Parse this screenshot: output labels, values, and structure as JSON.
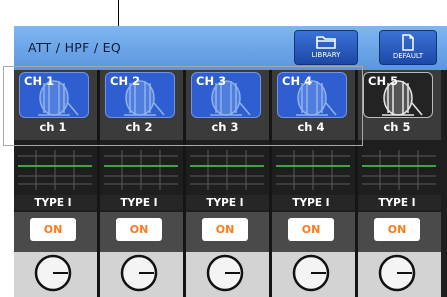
{
  "header": {
    "title": "ATT / HPF / EQ"
  },
  "buttons": {
    "library": "LIBRARY",
    "default": "DEFAULT"
  },
  "channels": [
    {
      "icon_label": "CH 1",
      "name": "ch 1",
      "eq_type": "TYPE I",
      "on_label": "ON",
      "selected": false
    },
    {
      "icon_label": "CH 2",
      "name": "ch 2",
      "eq_type": "TYPE I",
      "on_label": "ON",
      "selected": false
    },
    {
      "icon_label": "CH 3",
      "name": "ch 3",
      "eq_type": "TYPE I",
      "on_label": "ON",
      "selected": false
    },
    {
      "icon_label": "CH 4",
      "name": "ch 4",
      "eq_type": "TYPE I",
      "on_label": "ON",
      "selected": false
    },
    {
      "icon_label": "CH 5",
      "name": "ch 5",
      "eq_type": "TYPE I",
      "on_label": "ON",
      "selected": true
    }
  ],
  "colors": {
    "header": "#6fa8ec",
    "icon_blue": "#2f5ed1",
    "on_text": "#ff7a19",
    "knob_bg": "#d3d3d3"
  }
}
